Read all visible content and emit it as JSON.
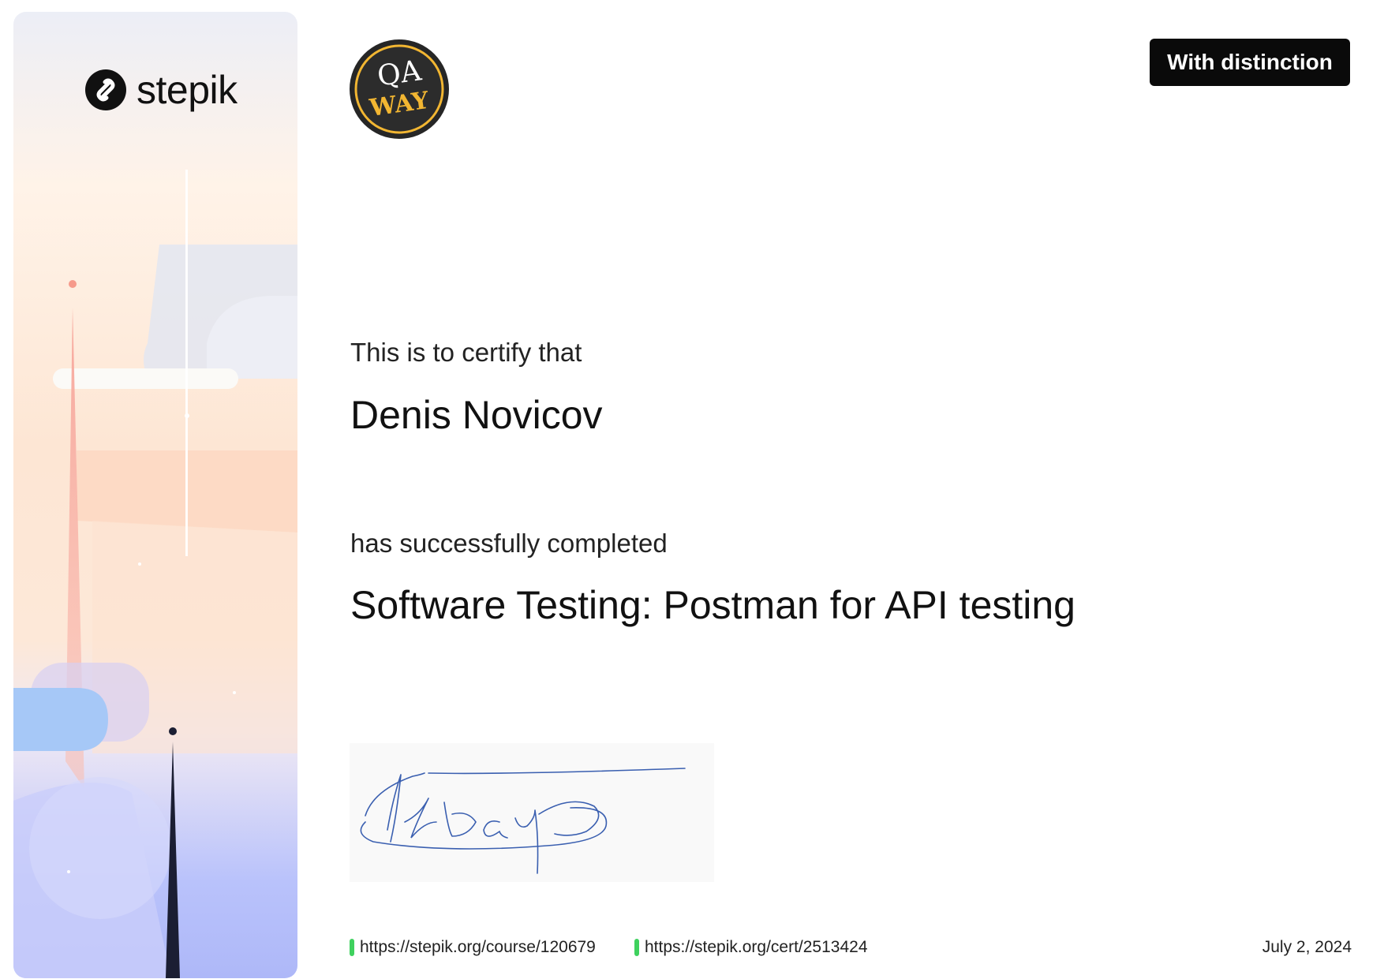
{
  "sidebar": {
    "logo_text": "stepik"
  },
  "badge": {
    "line1": "QA",
    "line2": "WAY"
  },
  "distinction_label": "With distinction",
  "certify_text": "This is to certify that",
  "recipient_name": "Denis Novicov",
  "completed_text": "has successfully completed",
  "course_title": "Software Testing: Postman for API testing",
  "footer": {
    "course_url": "https://stepik.org/course/120679",
    "cert_url": "https://stepik.org/cert/2513424",
    "date": "July 2, 2024"
  },
  "colors": {
    "accent_green": "#3fd15e",
    "badge_gold": "#f2b632",
    "badge_dark": "#222222",
    "signature_blue": "#3a5fb0"
  }
}
